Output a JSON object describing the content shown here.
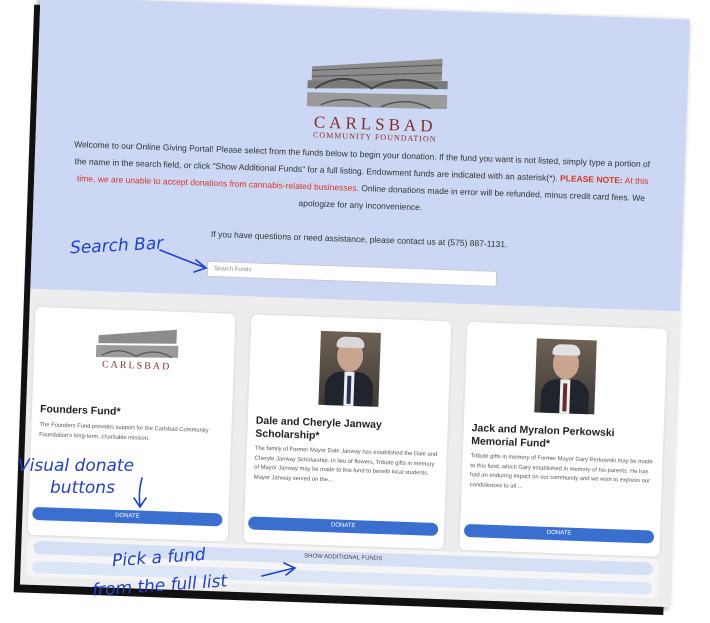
{
  "logo": {
    "name": "CARLSBAD",
    "subtitle": "COMMUNITY FOUNDATION"
  },
  "intro": {
    "line1": "Welcome to our Online Giving Portal! Please select from the funds below to begin your donation. If the fund you want is not listed, simply type a portion of the name in the search field, or click \"Show Additional Funds\" for a full listing. Endowment funds are indicated with an asterisk(*).",
    "warn_head": "PLEASE NOTE:",
    "warn_text": "At this time, we are unable to accept donations from cannabis-related businesses.",
    "line3": " Online donations made in error will be refunded, minus credit card fees. We apologize for any inconvenience.",
    "contact": "If you have questions or need assistance, please contact us at (575) 887-1131."
  },
  "search": {
    "placeholder": "Search Funds"
  },
  "funds": [
    {
      "title": "Founders Fund*",
      "desc": "The Founders Fund provides support for the Carlsbad Community Foundation's long-term, charitable mission.",
      "button": "DONATE"
    },
    {
      "title": "Dale and Cheryle Janway Scholarship*",
      "desc": "The family of Former Mayor Dale Janway has established the Dale and Cheryle Janway Scholarship. In lieu of flowers, Tribute gifts in memory of Mayor Janway may be made to this fund to benefit local students. Mayor Janway served on the...",
      "button": "DONATE"
    },
    {
      "title": "Jack and Myralon Perkowski Memorial Fund*",
      "desc": "Tribute gifts in memory of Former Mayor Gary Perkowski may be made to this fund, which Gary established in memory of his parents. He has had an enduring impact on our community and we wish to express our condolences to all ...",
      "button": "DONATE"
    }
  ],
  "more_button": "SHOW ADDITIONAL FUNDS",
  "annotations": {
    "search": "Search Bar",
    "donate1": "Visual donate",
    "donate2": "buttons",
    "pick1": "Pick a fund",
    "pick2": "from the full list"
  },
  "colors": {
    "hero": "#cbd7f3",
    "accent": "#3a6fd0",
    "warning": "#d8352a",
    "annotation": "#1f3fd1"
  }
}
